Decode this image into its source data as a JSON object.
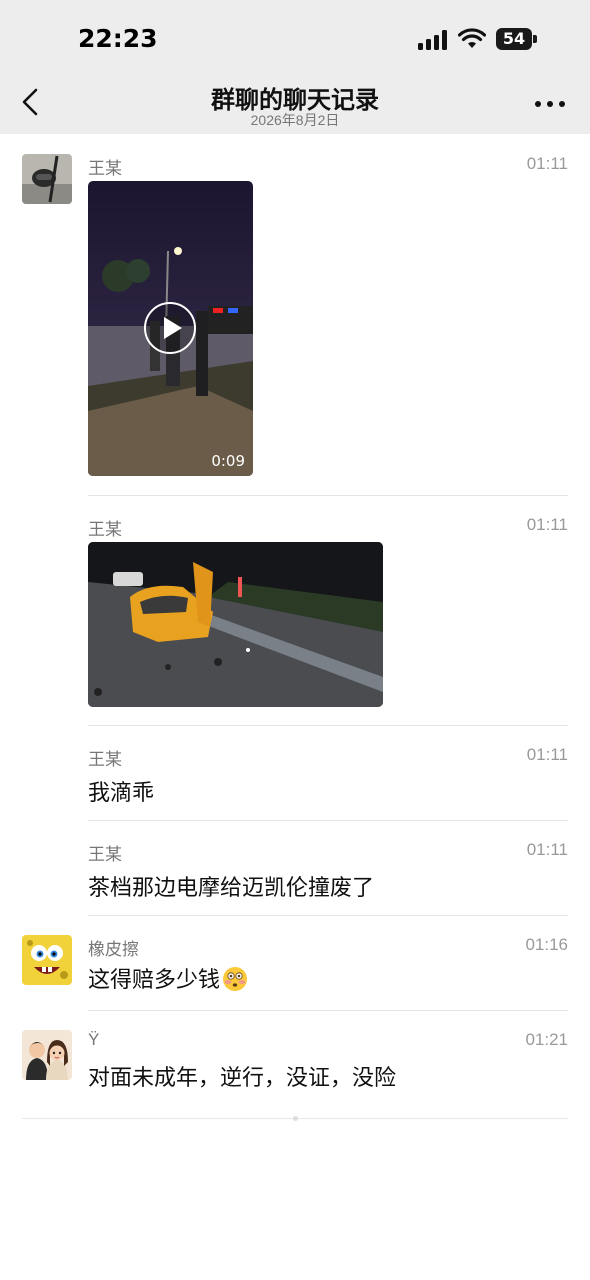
{
  "status_bar": {
    "time": "22:23",
    "battery": "54",
    "icons": [
      "signal-icon",
      "wifi-icon",
      "battery-icon"
    ]
  },
  "nav": {
    "title": "群聊的聊天记录",
    "subtitle": "2026年8月2日",
    "back_icon": "chevron-left-icon",
    "more_icon": "more-horizontal-icon"
  },
  "messages": [
    {
      "sender": "王某",
      "time": "01:11",
      "type": "video",
      "duration": "0:09"
    },
    {
      "sender": "王某",
      "time": "01:11",
      "type": "image"
    },
    {
      "sender": "王某",
      "time": "01:11",
      "type": "text",
      "text": "我滴乖"
    },
    {
      "sender": "王某",
      "time": "01:11",
      "type": "text",
      "text": "茶档那边电摩给迈凯伦撞废了"
    },
    {
      "sender": "橡皮擦",
      "time": "01:16",
      "type": "text",
      "text": "这得赔多少钱",
      "emoji": "flushed-face-icon"
    },
    {
      "sender": "Ÿ",
      "time": "01:21",
      "type": "text",
      "text": "对面未成年，逆行，没证，没险"
    }
  ],
  "colors": {
    "header_bg": "#ededed",
    "text": "#111111",
    "secondary": "#777777"
  }
}
